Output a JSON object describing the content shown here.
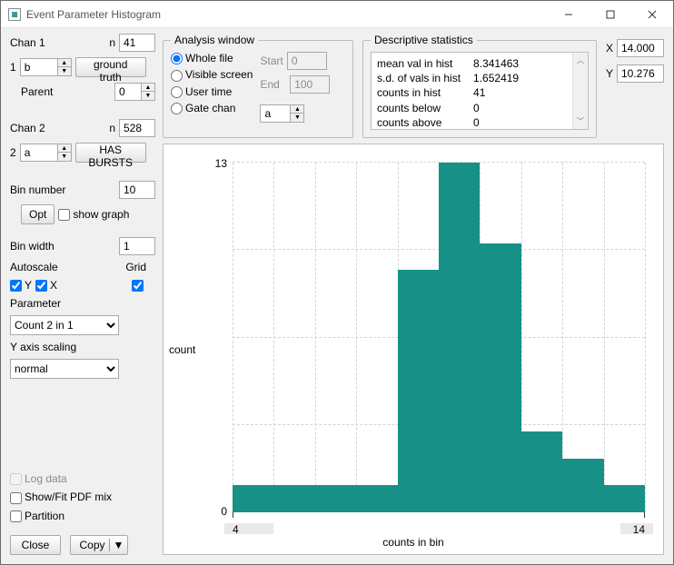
{
  "window": {
    "title": "Event Parameter Histogram"
  },
  "chan1": {
    "label": "Chan 1",
    "n_label": "n",
    "n": "41",
    "index": "1",
    "val": "b",
    "desc_btn": "ground truth",
    "parent_label": "Parent",
    "parent": "0"
  },
  "chan2": {
    "label": "Chan 2",
    "n_label": "n",
    "n": "528",
    "index": "2",
    "val": "a",
    "desc_btn": "HAS BURSTS"
  },
  "bin": {
    "number_label": "Bin number",
    "number": "10",
    "opt_btn": "Opt",
    "show_graph": "show graph",
    "width_label": "Bin width",
    "width": "1",
    "autoscale_label": "Autoscale",
    "grid_label": "Grid",
    "y_cb": "Y",
    "x_cb": "X",
    "param_label": "Parameter",
    "param_value": "Count 2 in 1",
    "yscale_label": "Y axis scaling",
    "yscale_value": "normal"
  },
  "opts": {
    "log_data": "Log data",
    "showfit": "Show/Fit PDF mix",
    "partition": "Partition"
  },
  "buttons": {
    "close": "Close",
    "copy": "Copy"
  },
  "analysis": {
    "legend": "Analysis window",
    "whole": "Whole file",
    "visible": "Visible screen",
    "user": "User time",
    "gate": "Gate chan",
    "start_label": "Start",
    "start": "0",
    "end_label": "End",
    "end": "100",
    "gate_val": "a"
  },
  "desc": {
    "legend": "Descriptive statistics",
    "rows": [
      {
        "k": "mean val in hist",
        "v": "8.341463"
      },
      {
        "k": "s.d. of vals in hist",
        "v": "1.652419"
      },
      {
        "k": "counts in hist",
        "v": "41"
      },
      {
        "k": "counts below",
        "v": "0"
      },
      {
        "k": "counts above",
        "v": "0"
      }
    ]
  },
  "xy": {
    "X_label": "X",
    "X": "14.000",
    "Y_label": "Y",
    "Y": "10.276"
  },
  "chart_data": {
    "type": "bar",
    "xlabel": "counts in bin",
    "ylabel": "count",
    "xlim": [
      4,
      14
    ],
    "ylim": [
      0,
      13
    ],
    "categories": [
      4,
      5,
      6,
      7,
      8,
      9,
      10,
      11,
      12,
      13
    ],
    "values": [
      1,
      1,
      1,
      1,
      9,
      13,
      10,
      3,
      2,
      1
    ],
    "y_ticks": [
      0,
      13.0
    ],
    "x_ticks": [
      4.0,
      14.0
    ]
  }
}
